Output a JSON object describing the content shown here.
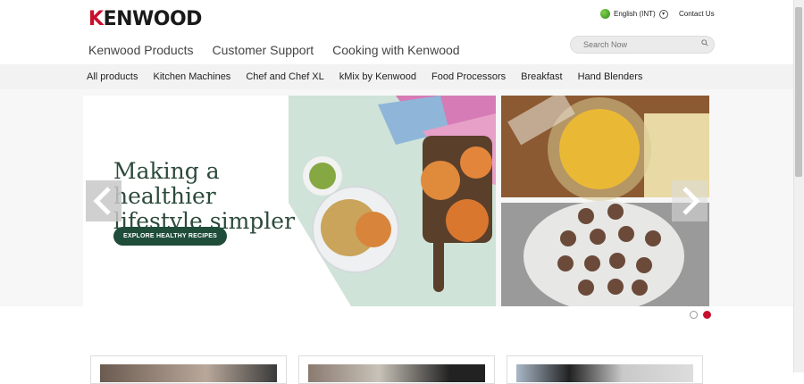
{
  "header": {
    "logo_text": "KENWOOD",
    "language": "English (INT)",
    "contact": "Contact Us",
    "nav": [
      "Kenwood Products",
      "Customer Support",
      "Cooking with Kenwood"
    ],
    "search_placeholder": "Search Now"
  },
  "categories": [
    "All products",
    "Kitchen Machines",
    "Chef and Chef XL",
    "kMix by Kenwood",
    "Food Processors",
    "Breakfast",
    "Hand Blenders"
  ],
  "hero": {
    "headline_line1": "Making a healthier",
    "headline_line2": "lifestyle simpler",
    "cta": "EXPLORE HEALTHY RECIPES",
    "slide_count": 2,
    "active_slide": 2
  },
  "colors": {
    "brand_red": "#c8102e",
    "cta_green": "#1f4d3a",
    "headline_green": "#2c4a3b"
  }
}
